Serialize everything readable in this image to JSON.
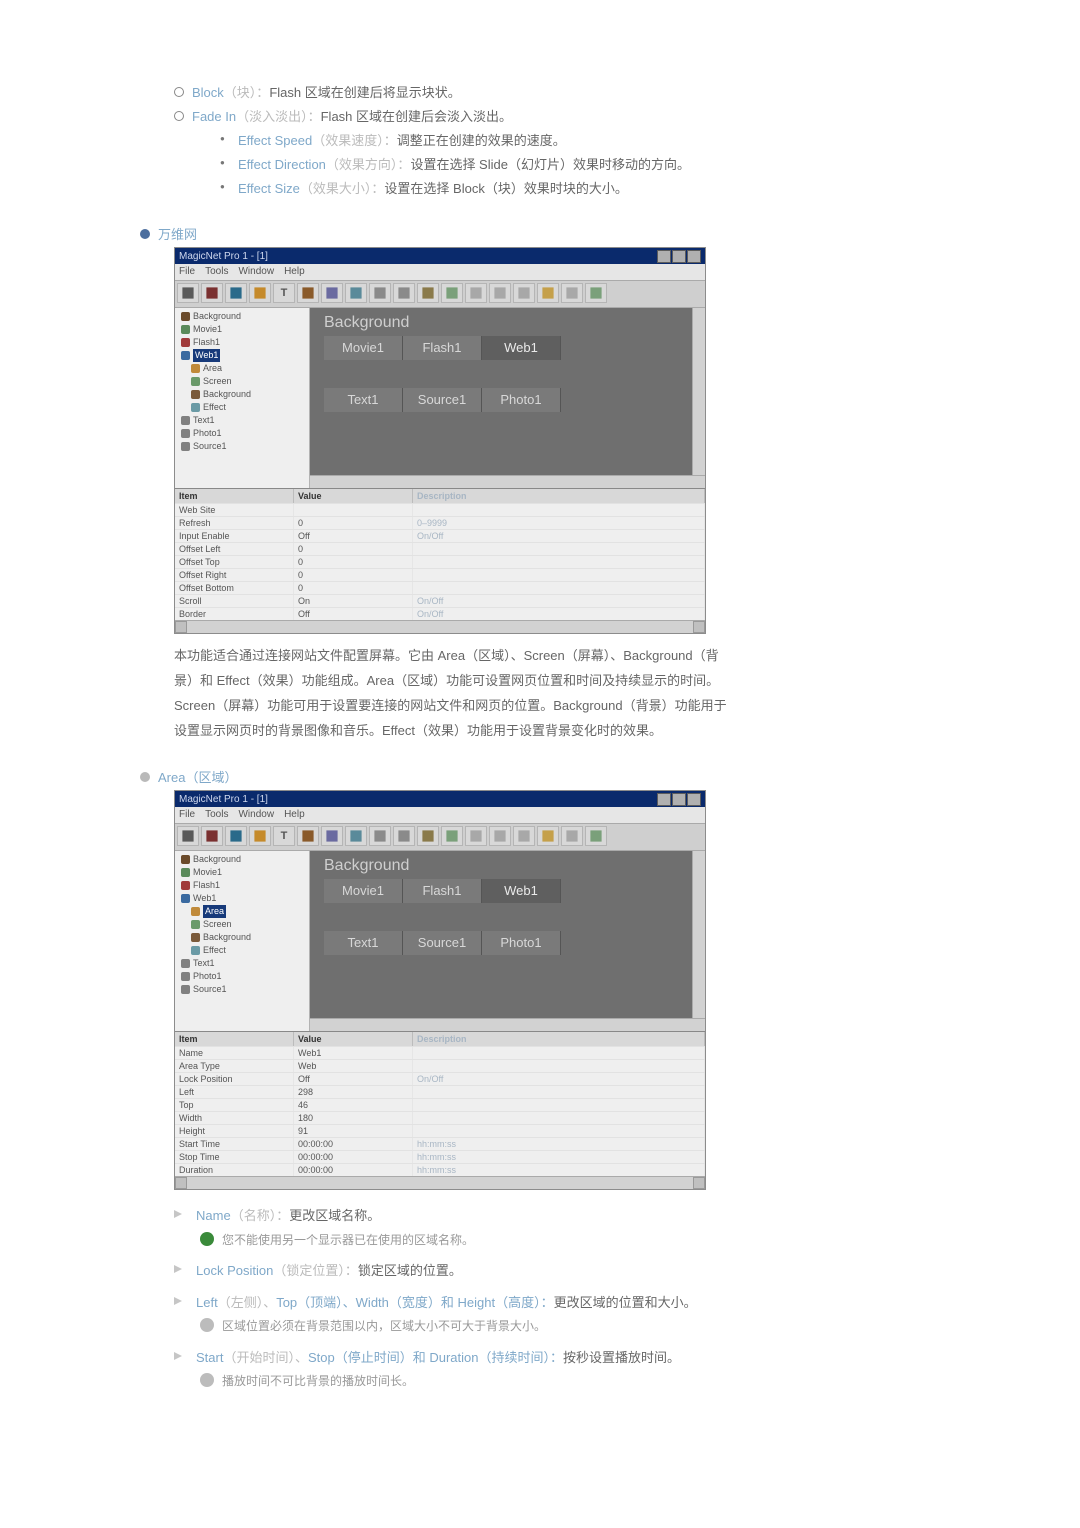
{
  "top_bullets_lvl2": [
    {
      "term": "Block",
      "term_note": "（块）：",
      "rest": "Flash 区域在创建后将显示块状。"
    },
    {
      "term": "Fade In",
      "term_note": "（淡入淡出）：",
      "rest": "Flash 区域在创建后会淡入淡出。"
    }
  ],
  "top_bullets_lvl1": [
    {
      "term": "Effect Speed",
      "term_note": "（效果速度）：",
      "rest": "调整正在创建的效果的速度。"
    },
    {
      "term": "Effect Direction",
      "term_note": "（效果方向）：",
      "rest": "设置在选择 Slide（幻灯片）效果时移动的方向。"
    },
    {
      "term": "Effect Size",
      "term_note": "（效果大小）：",
      "rest": "设置在选择 Block（块）效果时块的大小。"
    }
  ],
  "section_wanwei": "万维网",
  "section_area": "Area（区域）",
  "app": {
    "title": "MagicNet Pro 1 - [1]",
    "menus": [
      "File",
      "Tools",
      "Window",
      "Help"
    ],
    "toolbar_icons": [
      {
        "name": "new-icon",
        "fill": "#5a5a5a"
      },
      {
        "name": "screen-icon",
        "fill": "#7a3030"
      },
      {
        "name": "globe-icon",
        "fill": "#2a6a8a"
      },
      {
        "name": "layout-icon",
        "fill": "#c58a2a"
      },
      {
        "name": "text-icon",
        "label": "T",
        "fill": "#5a5a5a"
      },
      {
        "name": "movie-icon",
        "fill": "#8a5a2a"
      },
      {
        "name": "save-icon",
        "fill": "#6a6aa0"
      },
      {
        "name": "image-icon",
        "fill": "#5a8a9a"
      },
      {
        "name": "align1-icon",
        "fill": "#8a8a8a"
      },
      {
        "name": "align2-icon",
        "fill": "#8a8a8a"
      },
      {
        "name": "sound-icon",
        "fill": "#8a7a4a"
      },
      {
        "name": "clock-icon",
        "fill": "#7aa07a"
      },
      {
        "name": "back-icon",
        "fill": "#a8a8a8"
      },
      {
        "name": "layer1-icon",
        "fill": "#a8a8a8"
      },
      {
        "name": "layer2-icon",
        "fill": "#a8a8a8"
      },
      {
        "name": "undo-icon",
        "fill": "#c5a04a"
      },
      {
        "name": "redo-icon",
        "fill": "#a8a8a8"
      },
      {
        "name": "stop-icon",
        "fill": "#7aa07a"
      }
    ]
  },
  "tree_shot1": [
    {
      "d": 0,
      "icon": "#6a4a2a",
      "label": "Background"
    },
    {
      "d": 0,
      "icon": "#5a8a5a",
      "label": "Movie1"
    },
    {
      "d": 0,
      "icon": "#a03a3a",
      "label": "Flash1"
    },
    {
      "d": 0,
      "icon": "#3a6aa0",
      "label": "Web1",
      "selected": true
    },
    {
      "d": 1,
      "icon": "#c08a3a",
      "label": "Area"
    },
    {
      "d": 1,
      "icon": "#6a9a6a",
      "label": "Screen"
    },
    {
      "d": 1,
      "icon": "#7a5a3a",
      "label": "Background"
    },
    {
      "d": 1,
      "icon": "#6a9aa5",
      "label": "Effect"
    },
    {
      "d": 0,
      "icon": "#808080",
      "label": "Text1"
    },
    {
      "d": 0,
      "icon": "#808080",
      "label": "Photo1"
    },
    {
      "d": 0,
      "icon": "#808080",
      "label": "Source1"
    }
  ],
  "tree_shot2": [
    {
      "d": 0,
      "icon": "#6a4a2a",
      "label": "Background"
    },
    {
      "d": 0,
      "icon": "#5a8a5a",
      "label": "Movie1"
    },
    {
      "d": 0,
      "icon": "#a03a3a",
      "label": "Flash1"
    },
    {
      "d": 0,
      "icon": "#3a6aa0",
      "label": "Web1"
    },
    {
      "d": 1,
      "icon": "#c08a3a",
      "label": "Area",
      "selected": true
    },
    {
      "d": 1,
      "icon": "#6a9a6a",
      "label": "Screen"
    },
    {
      "d": 1,
      "icon": "#7a5a3a",
      "label": "Background"
    },
    {
      "d": 1,
      "icon": "#6a9aa5",
      "label": "Effect"
    },
    {
      "d": 0,
      "icon": "#808080",
      "label": "Text1"
    },
    {
      "d": 0,
      "icon": "#808080",
      "label": "Photo1"
    },
    {
      "d": 0,
      "icon": "#808080",
      "label": "Source1"
    }
  ],
  "canvas": {
    "bg_label": "Background",
    "row1": [
      "Movie1",
      "Flash1",
      "Web1"
    ],
    "row2": [
      "Text1",
      "Source1",
      "Photo1"
    ],
    "active_row1": 2,
    "active_row2": -1
  },
  "prop_headers": [
    "Item",
    "Value",
    "Description"
  ],
  "props_shot1": [
    {
      "k": "Web Site",
      "v": "",
      "d": ""
    },
    {
      "k": "Refresh",
      "v": "0",
      "d": "0–9999"
    },
    {
      "k": "Input Enable",
      "v": "Off",
      "d": "On/Off"
    },
    {
      "k": "Offset Left",
      "v": "0",
      "d": ""
    },
    {
      "k": "Offset Top",
      "v": "0",
      "d": ""
    },
    {
      "k": "Offset Right",
      "v": "0",
      "d": ""
    },
    {
      "k": "Offset Bottom",
      "v": "0",
      "d": ""
    },
    {
      "k": "Scroll",
      "v": "On",
      "d": "On/Off"
    },
    {
      "k": "Border",
      "v": "Off",
      "d": "On/Off"
    }
  ],
  "props_shot2": [
    {
      "k": "Name",
      "v": "Web1",
      "d": ""
    },
    {
      "k": "Area Type",
      "v": "Web",
      "d": ""
    },
    {
      "k": "Lock Position",
      "v": "Off",
      "d": "On/Off"
    },
    {
      "k": "Left",
      "v": "298",
      "d": ""
    },
    {
      "k": "Top",
      "v": "46",
      "d": ""
    },
    {
      "k": "Width",
      "v": "180",
      "d": ""
    },
    {
      "k": "Height",
      "v": "91",
      "d": ""
    },
    {
      "k": "Start Time",
      "v": "00:00:00",
      "d": "hh:mm:ss"
    },
    {
      "k": "Stop Time",
      "v": "00:00:00",
      "d": "hh:mm:ss"
    },
    {
      "k": "Duration",
      "v": "00:00:00",
      "d": "hh:mm:ss"
    }
  ],
  "para1": "本功能适合通过连接网站文件配置屏幕。它由 Area（区域）、Screen（屏幕）、Background（背景）和 Effect（效果）功能组成。Area（区域）功能可设置网页位置和时间及持续显示的时间。Screen（屏幕）功能可用于设置要连接的网站文件和网页的位置。Background（背景）功能用于设置显示网页时的背景图像和音乐。Effect（效果）功能用于设置背景变化时的效果。",
  "bottom_list": [
    {
      "term": "Name",
      "term_note": "（名称）：",
      "rest": "更改区域名称。",
      "note": {
        "kind": "green",
        "text": "您不能使用另一个显示器已在使用的区域名称。"
      }
    },
    {
      "term": "Lock Position",
      "term_note": "（锁定位置）：",
      "rest": "锁定区域的位置。"
    },
    {
      "term": "Left",
      "term_note": "（左侧）、",
      "extra": "Top（顶端）、Width（宽度）和 Height（高度）：",
      "rest": "更改区域的位置和大小。",
      "note": {
        "kind": "grey",
        "text": "区域位置必须在背景范围以内，区域大小不可大于背景大小。"
      }
    },
    {
      "term": "Start",
      "term_note": "（开始时间）、",
      "extra": "Stop（停止时间）和 Duration（持续时间）：",
      "rest": "按秒设置播放时间。",
      "note": {
        "kind": "grey",
        "text": "播放时间不可比背景的播放时间长。"
      }
    }
  ]
}
